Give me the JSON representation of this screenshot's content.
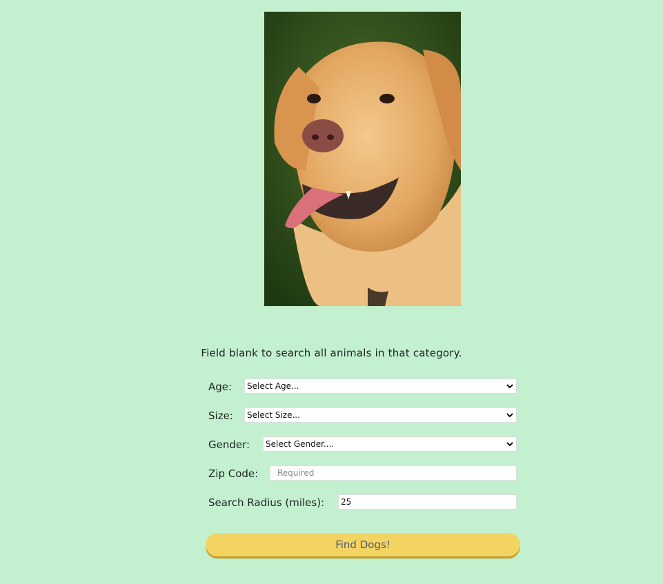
{
  "hero_image": {
    "alt_icon": "dog-photo"
  },
  "hint": "Field blank to search all animals in that category.",
  "form": {
    "age": {
      "label": "Age:",
      "value": "Select Age..."
    },
    "size": {
      "label": "Size:",
      "value": "Select Size..."
    },
    "gender": {
      "label": "Gender:",
      "value": "Select Gender...."
    },
    "zip": {
      "label": "Zip Code:",
      "placeholder": "Required",
      "value": ""
    },
    "radius": {
      "label": "Search Radius (miles):",
      "value": "25"
    }
  },
  "submit_label": "Find Dogs!",
  "colors": {
    "background": "#c3f1d0",
    "button": "#f3d462",
    "button_text": "#4a5a72"
  }
}
